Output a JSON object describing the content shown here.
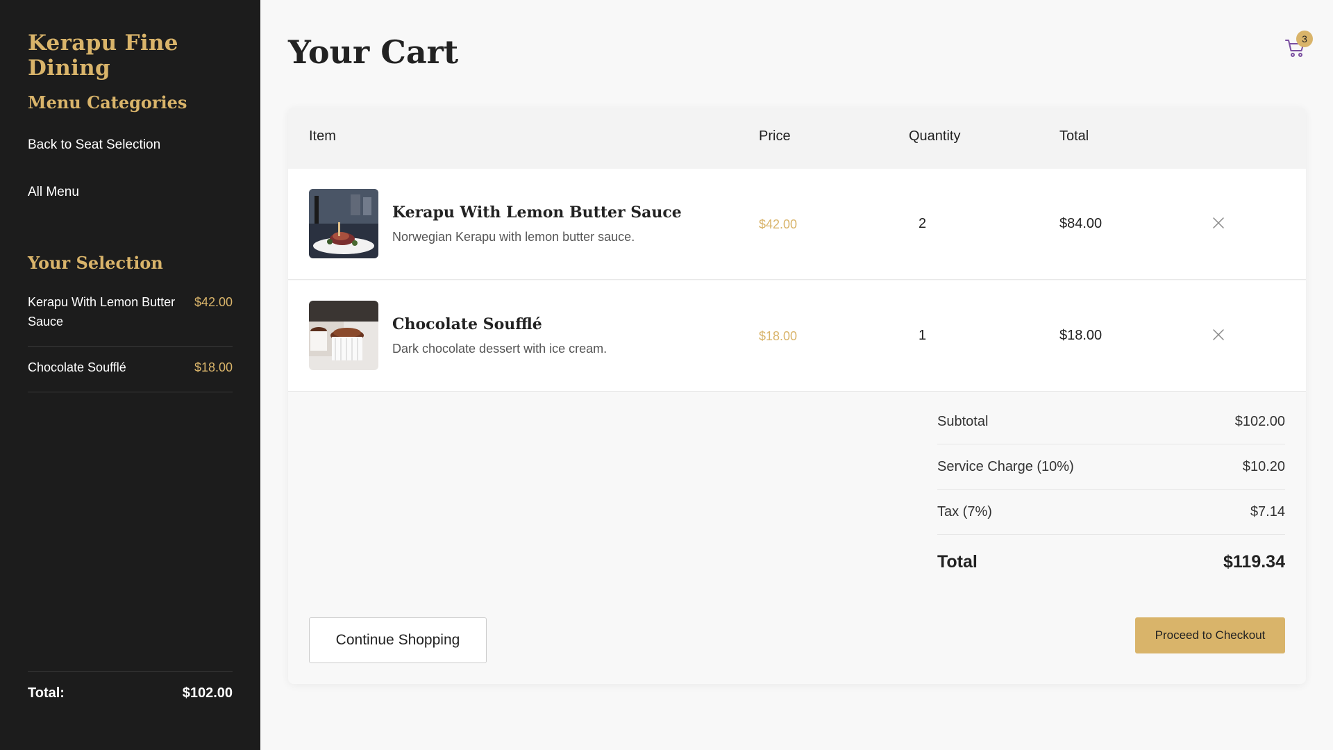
{
  "sidebar": {
    "brand": "Kerapu Fine Dining",
    "menu_heading": "Menu Categories",
    "links": [
      "Back to Seat Selection",
      "All Menu"
    ],
    "selection_heading": "Your Selection",
    "selection": [
      {
        "name": "Kerapu With Lemon Butter Sauce",
        "price": "$42.00"
      },
      {
        "name": "Chocolate Soufflé",
        "price": "$18.00"
      }
    ],
    "total_label": "Total:",
    "total_value": "$102.00"
  },
  "header": {
    "title": "Your Cart",
    "cart_icon": "shopping-cart-icon",
    "cart_count": "3"
  },
  "table": {
    "headers": [
      "Item",
      "Price",
      "Quantity",
      "Total"
    ],
    "rows": [
      {
        "name": "Kerapu With Lemon Butter Sauce",
        "description": "Norwegian Kerapu with lemon butter sauce.",
        "price": "$42.00",
        "quantity": "2",
        "total": "$84.00",
        "image": "fish-dish-photo"
      },
      {
        "name": "Chocolate Soufflé",
        "description": "Dark chocolate dessert with ice cream.",
        "price": "$18.00",
        "quantity": "1",
        "total": "$18.00",
        "image": "chocolate-souffle-photo"
      }
    ]
  },
  "summary": {
    "subtotal_label": "Subtotal",
    "subtotal_value": "$102.00",
    "service_label": "Service Charge (10%)",
    "service_value": "$10.20",
    "tax_label": "Tax (7%)",
    "tax_value": "$7.14",
    "total_label": "Total",
    "total_value": "$119.34"
  },
  "actions": {
    "continue_label": "Continue Shopping",
    "checkout_label": "Proceed to Checkout"
  },
  "colors": {
    "accent": "#d9b46a",
    "sidebar_bg": "#1c1c1c",
    "cart_icon": "#7a4fa0"
  }
}
